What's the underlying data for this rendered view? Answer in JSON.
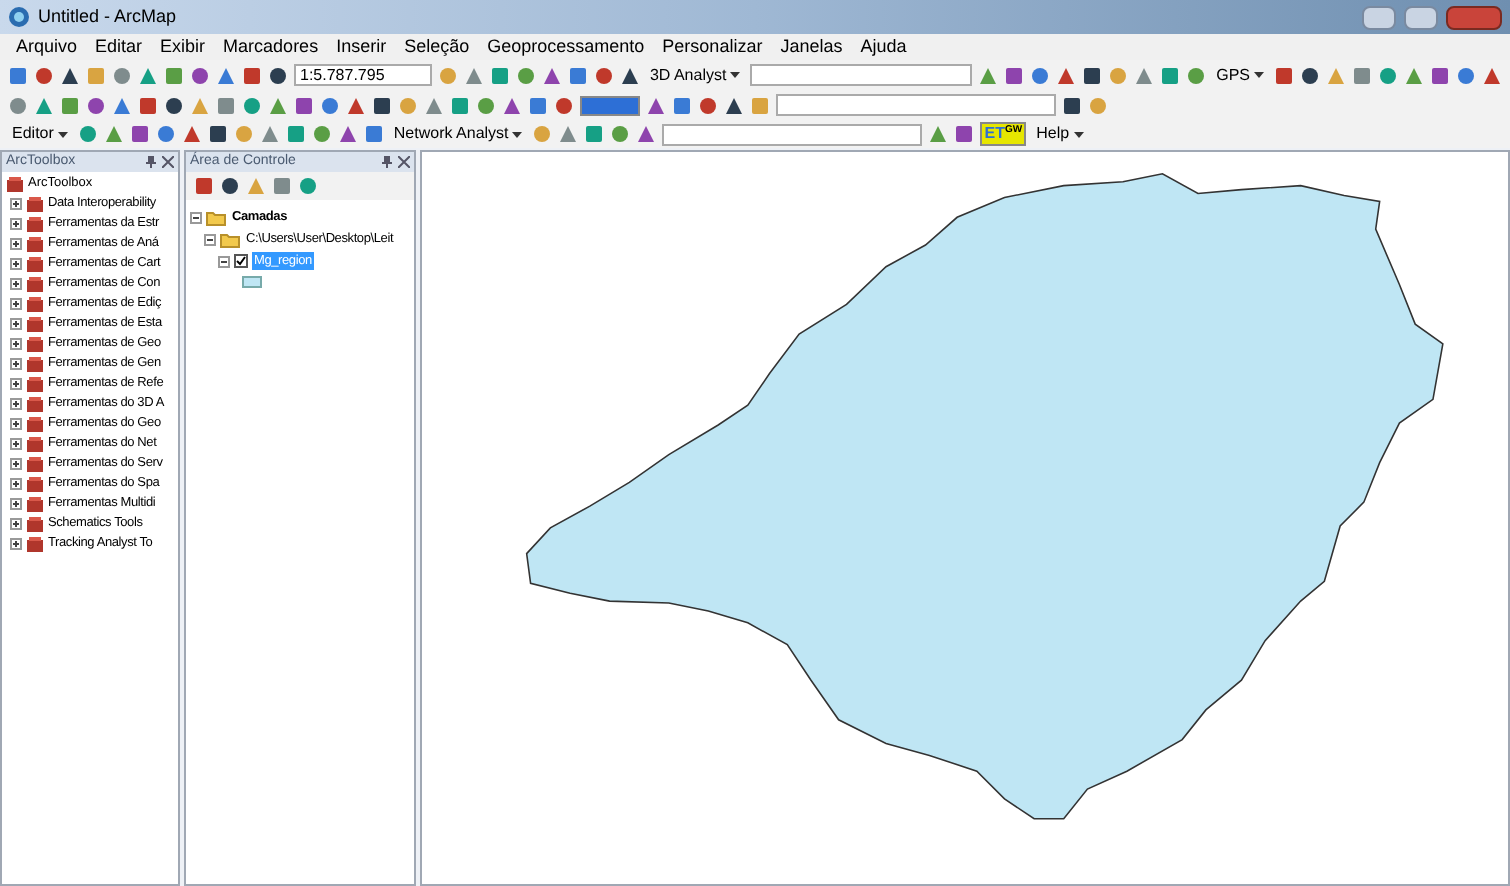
{
  "window": {
    "title": "Untitled - ArcMap"
  },
  "menu": [
    "Arquivo",
    "Editar",
    "Exibir",
    "Marcadores",
    "Inserir",
    "Seleção",
    "Geoprocessamento",
    "Personalizar",
    "Janelas",
    "Ajuda"
  ],
  "toolbars": {
    "scale": "1:5.787.795",
    "analyst_3d": "3D Analyst",
    "gps": "GPS",
    "editor": "Editor",
    "network_analyst": "Network Analyst",
    "help": "Help",
    "et_logo": "ET",
    "et_sup": "GW"
  },
  "toolbox": {
    "title": "ArcToolbox",
    "root": "ArcToolbox",
    "items": [
      {
        "label": "Data Interoperability"
      },
      {
        "label": "Ferramentas da Estr"
      },
      {
        "label": "Ferramentas de Aná"
      },
      {
        "label": "Ferramentas de Cart"
      },
      {
        "label": "Ferramentas de Con"
      },
      {
        "label": "Ferramentas de Ediç"
      },
      {
        "label": "Ferramentas de Esta"
      },
      {
        "label": "Ferramentas de Geo"
      },
      {
        "label": "Ferramentas de Gen"
      },
      {
        "label": "Ferramentas de Refe"
      },
      {
        "label": "Ferramentas do 3D A"
      },
      {
        "label": "Ferramentas do Geo"
      },
      {
        "label": "Ferramentas do Net"
      },
      {
        "label": "Ferramentas do Serv"
      },
      {
        "label": "Ferramentas do Spa"
      },
      {
        "label": "Ferramentas Multidi"
      },
      {
        "label": "Schematics Tools"
      },
      {
        "label": "Tracking Analyst To"
      }
    ]
  },
  "toc": {
    "title": "Área de Controle",
    "layers": [
      {
        "label": "Camadas",
        "expanded": true,
        "children": [
          {
            "label": "C:\\Users\\User\\Desktop\\Leit",
            "expanded": true,
            "children": [
              {
                "label": "Mg_region",
                "checked": true,
                "selected": true
              }
            ]
          }
        ]
      }
    ]
  }
}
